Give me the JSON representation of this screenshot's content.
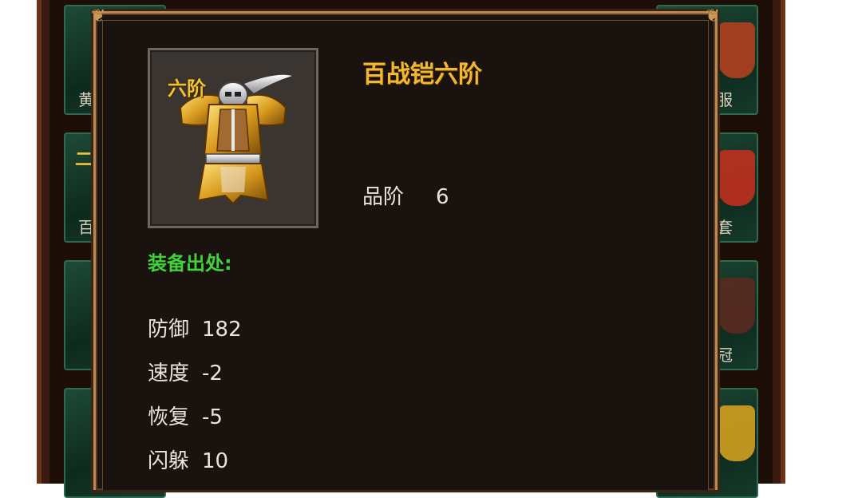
{
  "background": {
    "left_slots": [
      {
        "label": "黄"
      },
      {
        "label": "百"
      },
      {
        "label": ""
      },
      {
        "label": ""
      }
    ],
    "left_tag": "二",
    "right_slots": [
      {
        "label": "服"
      },
      {
        "label": "拳套"
      },
      {
        "label": "冠"
      },
      {
        "label": ""
      }
    ]
  },
  "tooltip": {
    "tier_badge": "六阶",
    "item_name": "百战铠六阶",
    "grade": {
      "label": "品阶",
      "value": "6"
    },
    "source_label": "装备出处:",
    "stats": [
      {
        "label": "防御",
        "value": "182"
      },
      {
        "label": "速度",
        "value": "-2"
      },
      {
        "label": "恢复",
        "value": "-5"
      },
      {
        "label": "闪躲",
        "value": "10"
      }
    ]
  },
  "colors": {
    "item_name": "#f1b830",
    "source_label": "#3fd23a",
    "stat_text": "#e8e4dc",
    "slot_green": "#1d4a36"
  },
  "icons": {
    "item": "golden-armor-icon"
  }
}
